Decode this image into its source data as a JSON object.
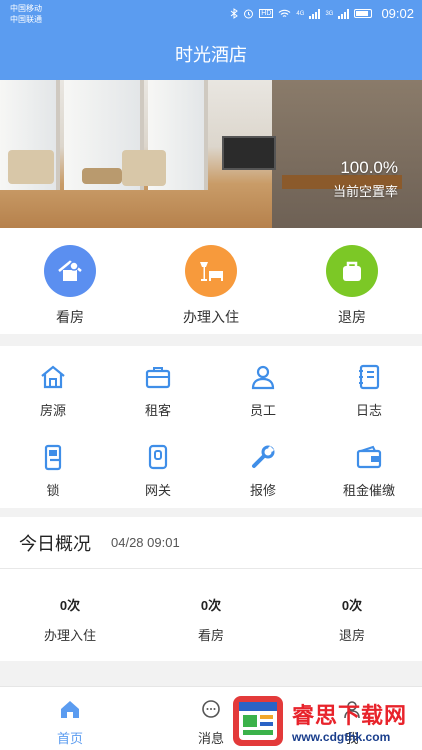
{
  "status_bar": {
    "carrier_1": "中国移动",
    "carrier_2": "中国联通",
    "hd": "HD",
    "net_1": "4G",
    "net_2": "3G",
    "time": "09:02"
  },
  "header": {
    "title": "时光酒店"
  },
  "banner": {
    "vacancy_value": "100.0%",
    "vacancy_label": "当前空置率"
  },
  "quick_actions": [
    {
      "label": "看房",
      "icon": "home-person-icon",
      "color": "#5b8ff0"
    },
    {
      "label": "办理入住",
      "icon": "lamp-bed-icon",
      "color": "#f79a3c"
    },
    {
      "label": "退房",
      "icon": "luggage-icon",
      "color": "#7cc826"
    }
  ],
  "menu": [
    {
      "label": "房源",
      "icon": "house-icon"
    },
    {
      "label": "租客",
      "icon": "briefcase-icon"
    },
    {
      "label": "员工",
      "icon": "staff-icon"
    },
    {
      "label": "日志",
      "icon": "notebook-icon"
    },
    {
      "label": "锁",
      "icon": "door-lock-icon"
    },
    {
      "label": "网关",
      "icon": "gateway-icon"
    },
    {
      "label": "报修",
      "icon": "wrench-icon"
    },
    {
      "label": "租金催缴",
      "icon": "wallet-icon"
    }
  ],
  "today": {
    "title": "今日概况",
    "datetime": "04/28 09:01",
    "stats": [
      {
        "value": "0次",
        "label": "办理入住"
      },
      {
        "value": "0次",
        "label": "看房"
      },
      {
        "value": "0次",
        "label": "退房"
      }
    ]
  },
  "bottom_nav": [
    {
      "label": "首页",
      "icon": "home-icon"
    },
    {
      "label": "消息",
      "icon": "message-icon"
    },
    {
      "label": "我",
      "icon": "profile-icon"
    }
  ],
  "colors": {
    "primary": "#5b9cf0",
    "icon_blue": "#3f8ee8"
  },
  "watermark": {
    "title": "睿思下载网",
    "url": "www.cdgthk.com"
  }
}
